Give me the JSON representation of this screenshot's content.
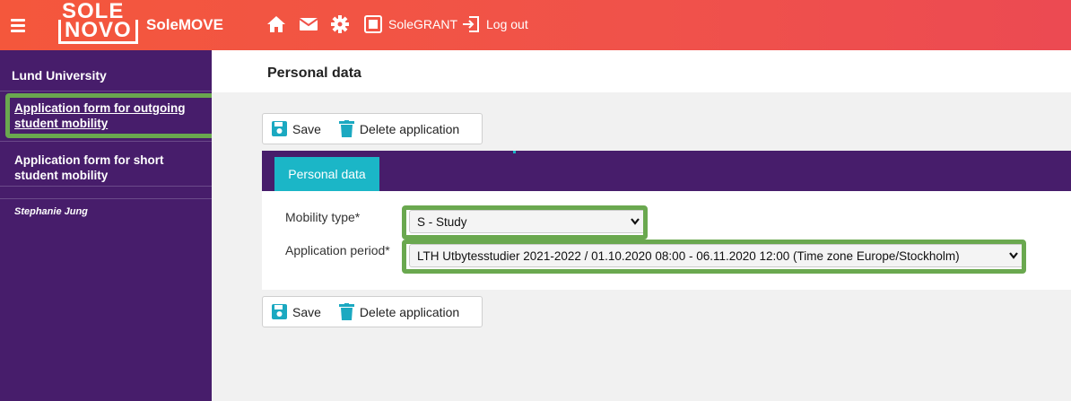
{
  "topbar": {
    "logo_line1": "SOLE",
    "logo_line2": "NOVO",
    "app_name": "SoleMOVE",
    "solegrant_label": "SoleGRANT",
    "logout_label": "Log out"
  },
  "sidebar": {
    "org": "Lund University",
    "items": [
      {
        "label": "Application form for outgoing student mobility"
      },
      {
        "label": "Application form for short student mobility"
      }
    ],
    "user": "Stephanie Jung"
  },
  "page": {
    "title": "Personal data"
  },
  "toolbar": {
    "save_label": "Save",
    "delete_label": "Delete application"
  },
  "form": {
    "tab_label": "Personal data",
    "mobility_type_label": "Mobility type*",
    "mobility_type_value": "S - Study",
    "application_period_label": "Application period*",
    "application_period_value": "LTH Utbytesstudier 2021-2022 / 01.10.2020 08:00 - 06.11.2020 12:00 (Time zone Europe/Stockholm)"
  },
  "colors": {
    "topbar": "#f0524a",
    "sidebar": "#471d6b",
    "tab_accent": "#1bb6c7",
    "highlight": "#6aa84f"
  }
}
